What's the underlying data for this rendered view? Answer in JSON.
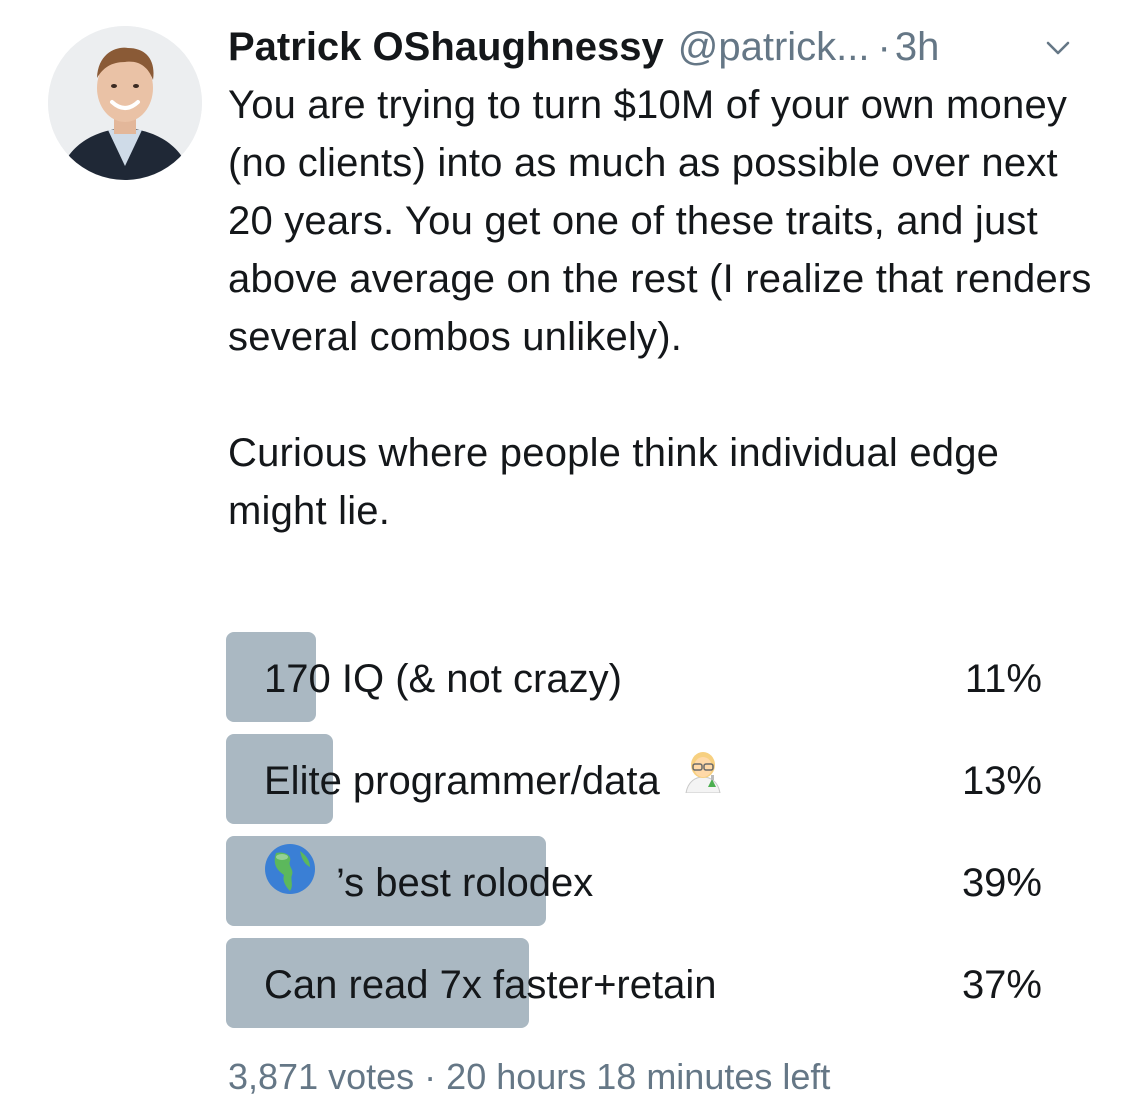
{
  "author": {
    "name": "Patrick OShaughnessy",
    "handle": "@patrick...",
    "separator": "·",
    "time": "3h",
    "avatar_icon": "profile-photo",
    "menu_icon": "chevron-down-icon"
  },
  "tweet": {
    "paragraphs": [
      "You are trying to turn $10M of your own money (no clients) into as much as possible over next 20 years. You get one of these traits, and just above average on the rest (I realize that renders several combos unlikely).",
      "Curious where people think individual edge might lie."
    ]
  },
  "poll": {
    "options": [
      {
        "label": "170 IQ (& not crazy)",
        "percent_text": "11%",
        "percent": 11
      },
      {
        "label": "Elite programmer/data",
        "icon_after": "woman-scientist-emoji",
        "percent_text": "13%",
        "percent": 13
      },
      {
        "label": "’s best rolodex",
        "icon_before": "globe-americas-emoji",
        "percent_text": "39%",
        "percent": 39
      },
      {
        "label": "Can read 7x faster+retain",
        "percent_text": "37%",
        "percent": 37
      }
    ],
    "votes": "3,871 votes",
    "separator": "·",
    "time_left": "20 hours 18 minutes left"
  },
  "colors": {
    "text": "#14171a",
    "secondary": "#657786",
    "poll_bar": "#aab8c2"
  }
}
